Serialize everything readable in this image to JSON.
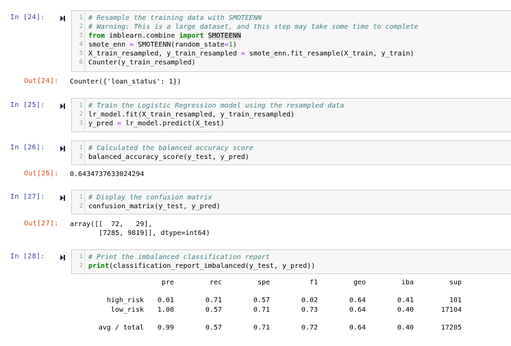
{
  "cells": [
    {
      "in_prompt": "In [24]:",
      "lines": [
        {
          "n": "1",
          "parts": [
            {
              "t": "# Resample the training data with SMOTEENN",
              "c": "cm"
            }
          ]
        },
        {
          "n": "2",
          "parts": [
            {
              "t": "# Warning: This is a large dataset, and this step may take some time to complete",
              "c": "cm"
            }
          ]
        },
        {
          "n": "3",
          "parts": [
            {
              "t": "from",
              "c": "kw"
            },
            {
              "t": " imblearn.combine ",
              "c": ""
            },
            {
              "t": "import",
              "c": "kw"
            },
            {
              "t": " ",
              "c": ""
            },
            {
              "t": "SMOTEENN",
              "c": "hl"
            }
          ]
        },
        {
          "n": "4",
          "parts": [
            {
              "t": "smote_enn ",
              "c": ""
            },
            {
              "t": "=",
              "c": "op"
            },
            {
              "t": " SMOTEENN(random_state",
              "c": ""
            },
            {
              "t": "=",
              "c": "op"
            },
            {
              "t": "1",
              "c": "num"
            },
            {
              "t": ")",
              "c": ""
            }
          ]
        },
        {
          "n": "5",
          "parts": [
            {
              "t": "X_train_resampled, y_train_resampled ",
              "c": ""
            },
            {
              "t": "=",
              "c": "op"
            },
            {
              "t": " smote_enn.fit_resample(X_train, y_train)",
              "c": ""
            }
          ]
        },
        {
          "n": "6",
          "parts": [
            {
              "t": "Counter(y_train_resampled)",
              "c": ""
            }
          ]
        }
      ],
      "out_prompt": "Out[24]:",
      "output": "Counter({'loan_status': 1})"
    },
    {
      "in_prompt": "In [25]:",
      "lines": [
        {
          "n": "1",
          "parts": [
            {
              "t": "# Train the Logistic Regression model using the resampled data",
              "c": "cm"
            }
          ]
        },
        {
          "n": "2",
          "parts": [
            {
              "t": "lr_model.fit(X_train_resampled, y_train_resampled)",
              "c": ""
            }
          ]
        },
        {
          "n": "3",
          "parts": [
            {
              "t": "y_pred ",
              "c": ""
            },
            {
              "t": "=",
              "c": "op"
            },
            {
              "t": " lr_model.predict(X_test)",
              "c": ""
            }
          ]
        }
      ]
    },
    {
      "in_prompt": "In [26]:",
      "lines": [
        {
          "n": "1",
          "parts": [
            {
              "t": "# Calculated the balanced accuracy score",
              "c": "cm"
            }
          ]
        },
        {
          "n": "2",
          "parts": [
            {
              "t": "balanced_accuracy_score(y_test, y_pred)",
              "c": ""
            }
          ]
        }
      ],
      "out_prompt": "Out[26]:",
      "output": "0.6434737633024294"
    },
    {
      "in_prompt": "In [27]:",
      "lines": [
        {
          "n": "1",
          "parts": [
            {
              "t": "# Display the confusion matrix",
              "c": "cm"
            }
          ]
        },
        {
          "n": "2",
          "parts": [
            {
              "t": "confusion_matrix(y_test, y_pred)",
              "c": ""
            }
          ]
        }
      ],
      "out_prompt": "Out[27]:",
      "output": "array([[  72,   29],\n       [7285, 9819]], dtype=int64)"
    },
    {
      "in_prompt": "In [28]:",
      "lines": [
        {
          "n": "1",
          "parts": [
            {
              "t": "# Print the imbalanced classification report",
              "c": "cm"
            }
          ]
        },
        {
          "n": "2",
          "parts": [
            {
              "t": "print",
              "c": "kw"
            },
            {
              "t": "(classification_report_imbalanced(y_test, y_pred))",
              "c": ""
            }
          ]
        }
      ]
    }
  ],
  "report": {
    "headers": [
      "",
      "pre",
      "rec",
      "spe",
      "f1",
      "geo",
      "iba",
      "sup"
    ],
    "rows": [
      [
        "high_risk",
        "0.01",
        "0.71",
        "0.57",
        "0.02",
        "0.64",
        "0.41",
        "101"
      ],
      [
        "low_risk",
        "1.00",
        "0.57",
        "0.71",
        "0.73",
        "0.64",
        "0.40",
        "17104"
      ],
      [
        "avg / total",
        "0.99",
        "0.57",
        "0.71",
        "0.72",
        "0.64",
        "0.40",
        "17205"
      ]
    ]
  }
}
